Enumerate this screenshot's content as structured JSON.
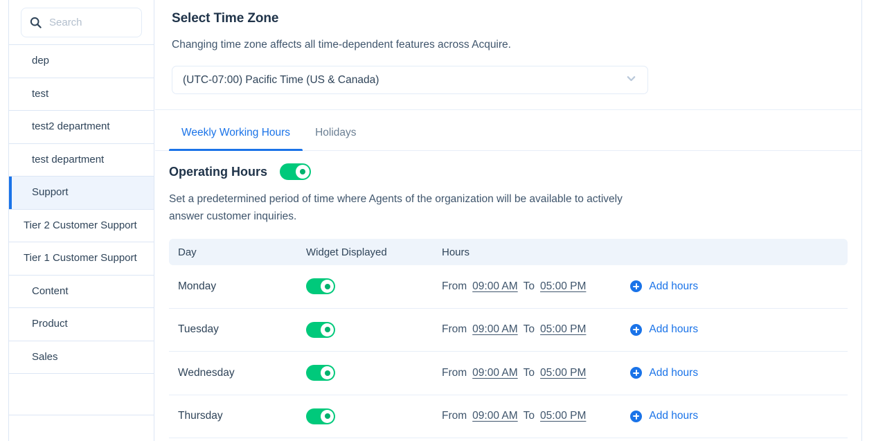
{
  "sidebar": {
    "search": {
      "placeholder": "Search",
      "value": "",
      "icon": "search-icon"
    },
    "items": [
      {
        "label": "dep",
        "selected": false
      },
      {
        "label": "test",
        "selected": false
      },
      {
        "label": "test2 department",
        "selected": false
      },
      {
        "label": "test department",
        "selected": false
      },
      {
        "label": "Support",
        "selected": true
      },
      {
        "label": "Tier 2 Customer Support",
        "selected": false
      },
      {
        "label": "Tier 1 Customer Support",
        "selected": false
      },
      {
        "label": "Content",
        "selected": false
      },
      {
        "label": "Product",
        "selected": false
      },
      {
        "label": "Sales",
        "selected": false
      }
    ]
  },
  "timezone": {
    "title": "Select Time Zone",
    "description": "Changing time zone affects all time-dependent features across Acquire.",
    "selected": "(UTC-07:00) Pacific Time (US & Canada)",
    "chevron_icon": "chevron-down-icon"
  },
  "tabs": [
    {
      "label": "Weekly Working Hours",
      "active": true
    },
    {
      "label": "Holidays",
      "active": false
    }
  ],
  "operating_hours": {
    "title": "Operating Hours",
    "enabled": true,
    "description": "Set a predetermined period of time where Agents of the organization will be available to actively answer customer inquiries."
  },
  "table": {
    "headers": {
      "day": "Day",
      "widget": "Widget Displayed",
      "hours": "Hours"
    },
    "labels": {
      "from": "From",
      "to": "To",
      "add_hours": "Add hours",
      "add_icon": "plus-circle-icon"
    },
    "rows": [
      {
        "day": "Monday",
        "widget_displayed": true,
        "from": "09:00 AM",
        "to": "05:00 PM"
      },
      {
        "day": "Tuesday",
        "widget_displayed": true,
        "from": "09:00 AM",
        "to": "05:00 PM"
      },
      {
        "day": "Wednesday",
        "widget_displayed": true,
        "from": "09:00 AM",
        "to": "05:00 PM"
      },
      {
        "day": "Thursday",
        "widget_displayed": true,
        "from": "09:00 AM",
        "to": "05:00 PM"
      }
    ]
  },
  "colors": {
    "accent_blue": "#1a73e8",
    "toggle_green": "#00c97b",
    "header_bg": "#eef4fb",
    "selected_bg": "#eef4fd",
    "text_dark": "#2f4459",
    "border": "#dce6f5"
  }
}
